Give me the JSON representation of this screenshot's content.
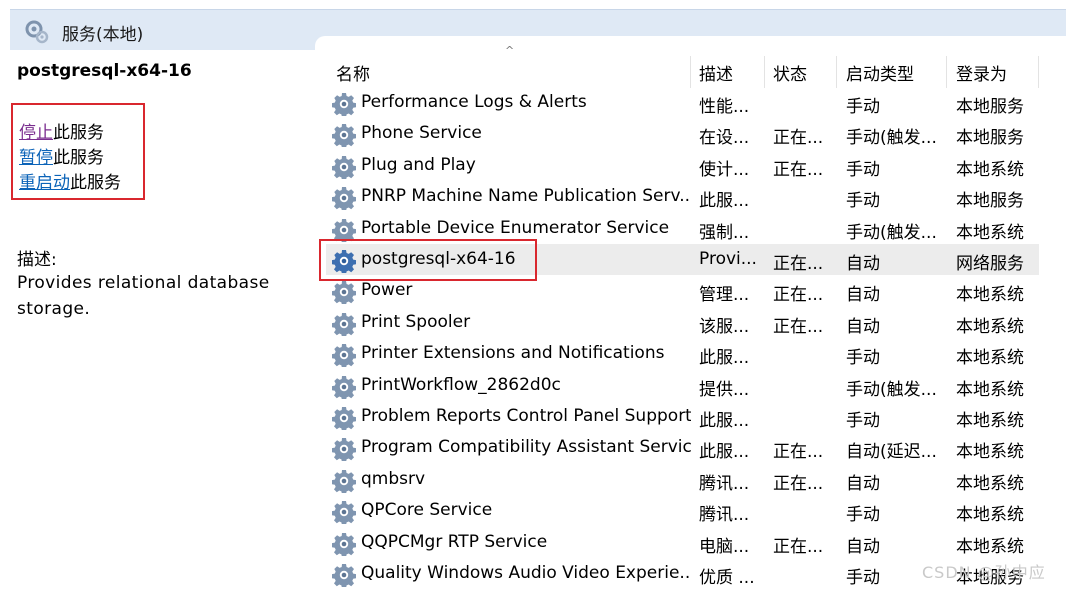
{
  "window": {
    "title": "服务(本地)"
  },
  "left": {
    "service_name": "postgresql-x64-16",
    "actions": [
      {
        "link": "停止",
        "suffix": "此服务"
      },
      {
        "link": "暂停",
        "suffix": "此服务"
      },
      {
        "link": "重启动",
        "suffix": "此服务"
      }
    ],
    "desc_label": "描述:",
    "desc_text": "Provides relational database storage."
  },
  "table": {
    "sort_indicator": "^",
    "headers": [
      "名称",
      "描述",
      "状态",
      "启动类型",
      "登录为"
    ],
    "rows": [
      {
        "name": "Performance Logs & Alerts",
        "desc": "性能...",
        "status": "",
        "startup": "手动",
        "logon": "本地服务"
      },
      {
        "name": "Phone Service",
        "desc": "在设...",
        "status": "正在...",
        "startup": "手动(触发...",
        "logon": "本地服务"
      },
      {
        "name": "Plug and Play",
        "desc": "使计...",
        "status": "正在...",
        "startup": "手动",
        "logon": "本地系统"
      },
      {
        "name": "PNRP Machine Name Publication Serv...",
        "desc": "此服...",
        "status": "",
        "startup": "手动",
        "logon": "本地服务"
      },
      {
        "name": "Portable Device Enumerator Service",
        "desc": "强制...",
        "status": "",
        "startup": "手动(触发...",
        "logon": "本地系统"
      },
      {
        "name": "postgresql-x64-16",
        "desc": "Provi...",
        "status": "正在...",
        "startup": "自动",
        "logon": "网络服务",
        "selected": true
      },
      {
        "name": "Power",
        "desc": "管理...",
        "status": "正在...",
        "startup": "自动",
        "logon": "本地系统"
      },
      {
        "name": "Print Spooler",
        "desc": "该服...",
        "status": "正在...",
        "startup": "自动",
        "logon": "本地系统"
      },
      {
        "name": "Printer Extensions and Notifications",
        "desc": "此服...",
        "status": "",
        "startup": "手动",
        "logon": "本地系统"
      },
      {
        "name": "PrintWorkflow_2862d0c",
        "desc": "提供...",
        "status": "",
        "startup": "手动(触发...",
        "logon": "本地系统"
      },
      {
        "name": "Problem Reports Control Panel Support",
        "desc": "此服...",
        "status": "",
        "startup": "手动",
        "logon": "本地系统"
      },
      {
        "name": "Program Compatibility Assistant Service",
        "desc": "此服...",
        "status": "正在...",
        "startup": "自动(延迟...",
        "logon": "本地系统"
      },
      {
        "name": "qmbsrv",
        "desc": "腾讯...",
        "status": "正在...",
        "startup": "自动",
        "logon": "本地系统"
      },
      {
        "name": "QPCore Service",
        "desc": "腾讯...",
        "status": "",
        "startup": "手动",
        "logon": "本地系统"
      },
      {
        "name": "QQPCMgr RTP Service",
        "desc": "电脑...",
        "status": "正在...",
        "startup": "自动",
        "logon": "本地系统"
      },
      {
        "name": "Quality Windows Audio Video Experie...",
        "desc": "优质 ...",
        "status": "",
        "startup": "手动",
        "logon": "本地服务"
      }
    ]
  },
  "watermark": "CSDN @孙中应",
  "icons": {
    "title": "services-icon",
    "row": "gear-icon"
  }
}
